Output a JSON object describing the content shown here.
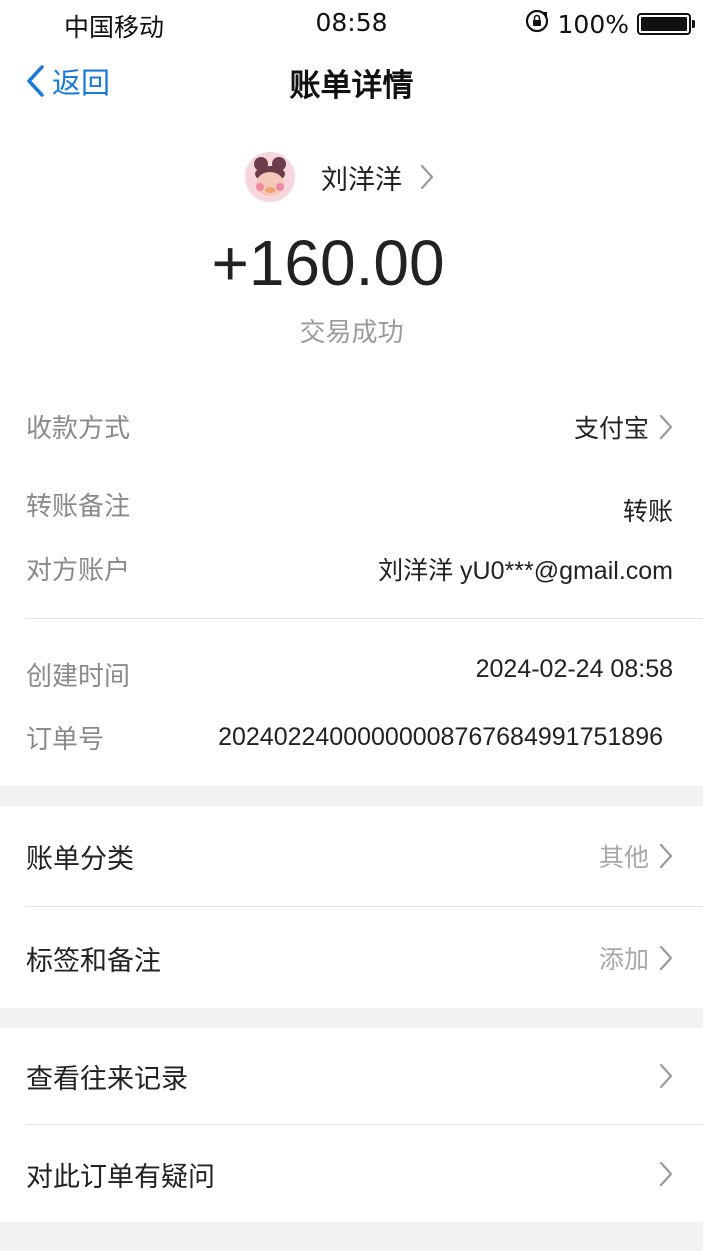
{
  "status_bar": {
    "carrier": "中国移动",
    "time": "08:58",
    "battery": "100%"
  },
  "nav": {
    "back_label": "返回",
    "title": "账单详情"
  },
  "header": {
    "payee_name": "刘洋洋",
    "amount": "+160.00",
    "status": "交易成功"
  },
  "details": {
    "method_label": "收款方式",
    "method_value": "支付宝",
    "note_label": "转账备注",
    "note_value": "转账",
    "account_label": "对方账户",
    "account_value": "刘洋洋 yU0***@gmail.com",
    "created_label": "创建时间",
    "created_value": "2024-02-24 08:58",
    "order_label": "订单号",
    "order_value": "2024022400000000876768499175189­6"
  },
  "group1": {
    "category_label": "账单分类",
    "category_value": "其他",
    "tags_label": "标签和备注",
    "tags_value": "添加"
  },
  "group2": {
    "history_label": "查看往来记录",
    "dispute_label": "对此订单有疑问"
  },
  "colors": {
    "accent": "#1a7bdb",
    "background": "#f2f2f4"
  }
}
